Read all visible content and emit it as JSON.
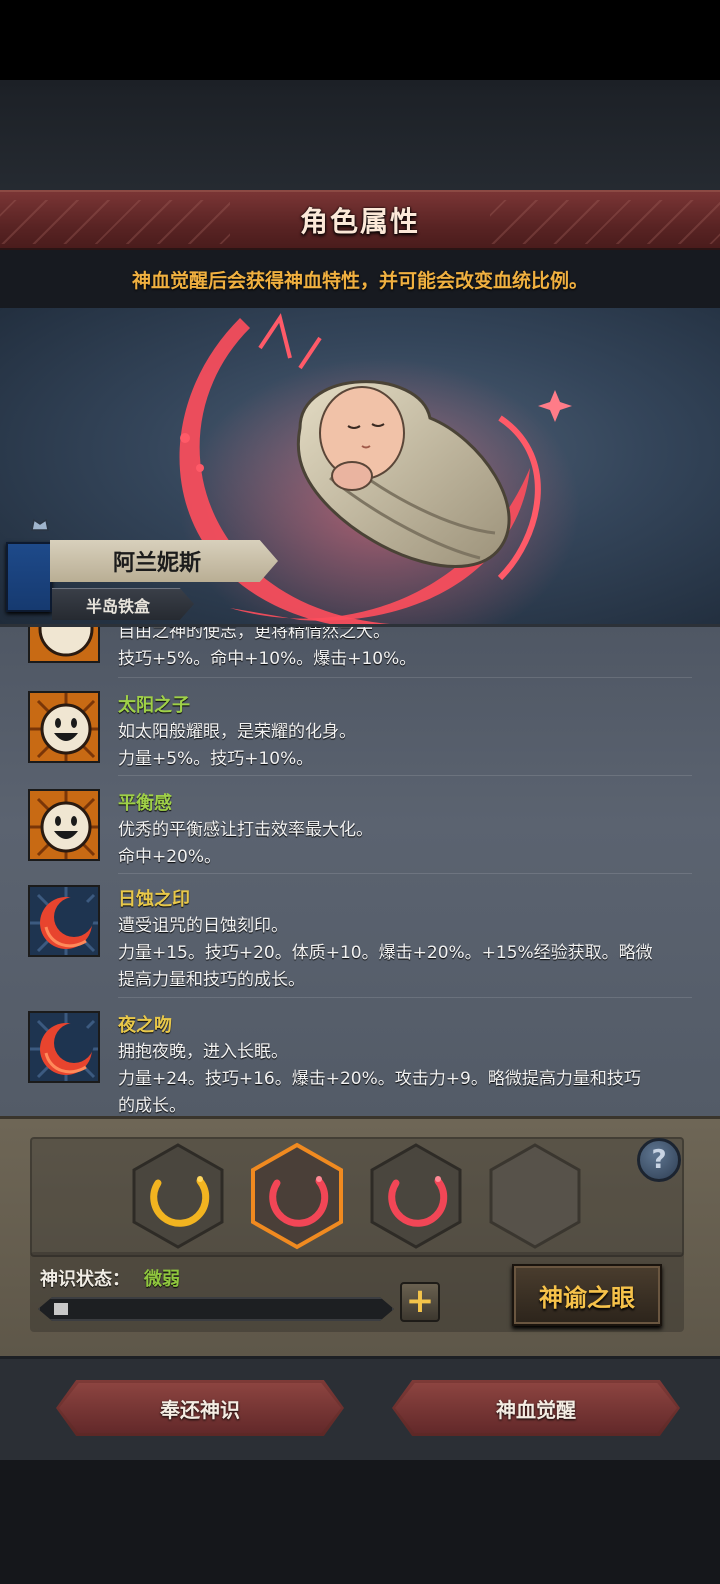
{
  "header": {
    "title": "角色属性",
    "subtitle": "神血觉醒后会获得神血特性，并可能会改变血统比例。"
  },
  "character": {
    "name": "阿兰妮斯",
    "origin": "半岛铁盒"
  },
  "traits": [
    {
      "name": "",
      "desc_lines": [
        "自由之神的使志，更将精情然之大。",
        "技巧+5%。命中+10%。爆击+10%。"
      ],
      "icon": "sun-face-icon",
      "name_color": "green"
    },
    {
      "name": "太阳之子",
      "desc_lines": [
        "如太阳般耀眼，是荣耀的化身。",
        "力量+5%。技巧+10%。"
      ],
      "icon": "sun-face-icon",
      "name_color": "green"
    },
    {
      "name": "平衡感",
      "desc_lines": [
        "优秀的平衡感让打击效率最大化。",
        "命中+20%。"
      ],
      "icon": "sun-face-icon",
      "name_color": "green"
    },
    {
      "name": "日蚀之印",
      "desc_lines": [
        "遭受诅咒的日蚀刻印。",
        "力量+15。技巧+20。体质+10。爆击+20%。+15%经验获取。略微",
        "提高力量和技巧的成长。"
      ],
      "icon": "eclipse-mark-icon",
      "name_color": "gold"
    },
    {
      "name": "夜之吻",
      "desc_lines": [
        "拥抱夜晚，进入长眠。",
        "力量+24。技巧+16。爆击+20%。攻击力+9。略微提高力量和技巧",
        "的成长。"
      ],
      "icon": "eclipse-mark-icon",
      "name_color": "gold"
    }
  ],
  "slots": [
    {
      "icon": "golden-crescent-icon",
      "state": "filled"
    },
    {
      "icon": "crimson-crescent-icon",
      "state": "selected"
    },
    {
      "icon": "crimson-crescent-icon",
      "state": "filled"
    },
    {
      "icon": "",
      "state": "empty"
    }
  ],
  "divine_sense": {
    "label": "神识状态：",
    "value": "微弱",
    "progress": 0.03
  },
  "buttons": {
    "oracle": "神谕之眼",
    "return": "奉还神识",
    "awaken": "神血觉醒",
    "plus": "+",
    "help": "?"
  },
  "colors": {
    "accent_gold": "#f6c24a",
    "trait_green": "#9fd048",
    "trait_gold": "#e8c84a",
    "status_green": "#8fc63e",
    "button_red": "#7e3a37"
  }
}
